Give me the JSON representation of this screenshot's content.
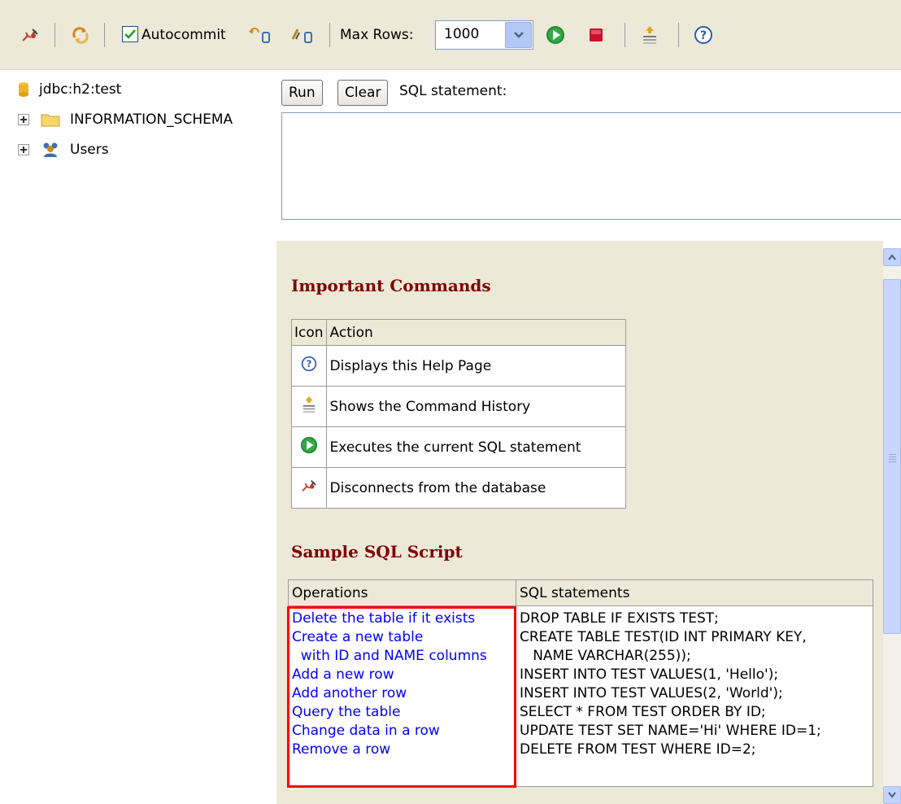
{
  "toolbar": {
    "autocommit_label": "Autocommit",
    "max_rows_label": "Max Rows:",
    "max_rows_value": "1000"
  },
  "tree": {
    "connection": "jdbc:h2:test",
    "items": [
      {
        "label": "INFORMATION_SCHEMA",
        "icon": "folder-icon"
      },
      {
        "label": "Users",
        "icon": "users-icon"
      }
    ]
  },
  "query": {
    "run_label": "Run",
    "clear_label": "Clear",
    "sql_label": "SQL statement:",
    "sql_value": ""
  },
  "help": {
    "commands_title": "Important Commands",
    "commands_headers": [
      "Icon",
      "Action"
    ],
    "commands": [
      {
        "icon": "help-icon",
        "action": "Displays this Help Page"
      },
      {
        "icon": "history-icon",
        "action": "Shows the Command History"
      },
      {
        "icon": "execute-icon",
        "action": "Executes the current SQL statement"
      },
      {
        "icon": "disconnect-icon",
        "action": "Disconnects from the database"
      }
    ],
    "script_title": "Sample SQL Script",
    "script_headers": [
      "Operations",
      "SQL statements"
    ],
    "operations": [
      "Delete the table if it exists",
      "Create a new table",
      "  with ID and NAME columns",
      "Add a new row",
      "Add another row",
      "Query the table",
      "Change data in a row",
      "Remove a row"
    ],
    "statements": [
      "DROP TABLE IF EXISTS TEST;",
      "CREATE TABLE TEST(ID INT PRIMARY KEY,",
      "   NAME VARCHAR(255));",
      "INSERT INTO TEST VALUES(1, 'Hello');",
      "INSERT INTO TEST VALUES(2, 'World');",
      "SELECT * FROM TEST ORDER BY ID;",
      "UPDATE TEST SET NAME='Hi' WHERE ID=1;",
      "DELETE FROM TEST WHERE ID=2;"
    ]
  },
  "colors": {
    "heading": "#800000",
    "link": "#0000ff",
    "highlight": "#ff0000",
    "panel": "#ece9d8"
  }
}
